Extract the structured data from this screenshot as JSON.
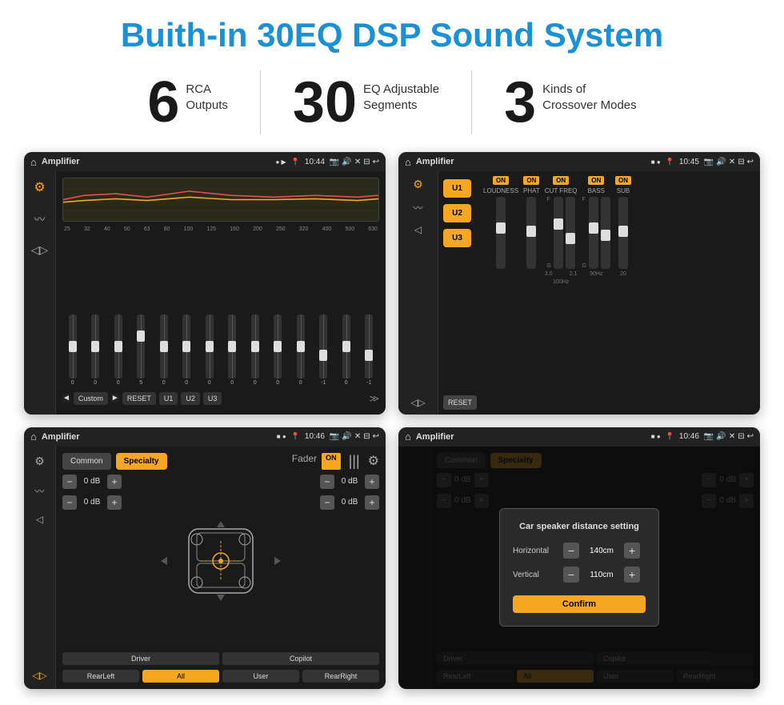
{
  "header": {
    "title": "Buith-in 30EQ DSP Sound System"
  },
  "stats": [
    {
      "number": "6",
      "line1": "RCA",
      "line2": "Outputs"
    },
    {
      "number": "30",
      "line1": "EQ Adjustable",
      "line2": "Segments"
    },
    {
      "number": "3",
      "line1": "Kinds of",
      "line2": "Crossover Modes"
    }
  ],
  "screen_tl": {
    "status_title": "Amplifier",
    "time": "10:44",
    "eq_freqs": [
      "25",
      "32",
      "40",
      "50",
      "63",
      "80",
      "100",
      "125",
      "160",
      "200",
      "250",
      "320",
      "400",
      "500",
      "630"
    ],
    "eq_vals": [
      "0",
      "0",
      "0",
      "5",
      "0",
      "0",
      "0",
      "0",
      "0",
      "0",
      "0",
      "-1",
      "0",
      "-1"
    ],
    "bottom_buttons": [
      "Custom",
      "RESET",
      "U1",
      "U2",
      "U3"
    ]
  },
  "screen_tr": {
    "status_title": "Amplifier",
    "time": "10:45",
    "u_buttons": [
      "U1",
      "U2",
      "U3"
    ],
    "channels": [
      "LOUDNESS",
      "PHAT",
      "CUT FREQ",
      "BASS",
      "SUB"
    ],
    "reset_label": "RESET"
  },
  "screen_bl": {
    "status_title": "Amplifier",
    "time": "10:46",
    "tabs": [
      "Common",
      "Specialty"
    ],
    "fader_label": "Fader",
    "fader_on": "ON",
    "vol_rows": [
      {
        "val": "0 dB"
      },
      {
        "val": "0 dB"
      },
      {
        "val": "0 dB"
      },
      {
        "val": "0 dB"
      }
    ],
    "bottom_btns": [
      "Driver",
      "",
      "Copilot",
      "RearLeft",
      "All",
      "User",
      "RearRight"
    ]
  },
  "screen_br": {
    "status_title": "Amplifier",
    "time": "10:46",
    "tabs": [
      "Common",
      "Specialty"
    ],
    "dialog": {
      "title": "Car speaker distance setting",
      "horizontal_label": "Horizontal",
      "horizontal_val": "140cm",
      "vertical_label": "Vertical",
      "vertical_val": "110cm",
      "confirm_label": "Confirm"
    },
    "vol_rows": [
      {
        "val": "0 dB"
      },
      {
        "val": "0 dB"
      }
    ],
    "bottom_btns": [
      "Driver",
      "Copilot",
      "RearLeft",
      "User",
      "RearRight"
    ]
  },
  "icons": {
    "home": "⌂",
    "music_wave": "〜",
    "speaker": "♪",
    "volume": "◁",
    "expand": "≫",
    "gear": "⚙",
    "back": "↩",
    "location": "📍",
    "camera": "📷",
    "sound": "🔊",
    "close": "✕",
    "window": "⊟",
    "minus": "−",
    "plus": "+"
  }
}
